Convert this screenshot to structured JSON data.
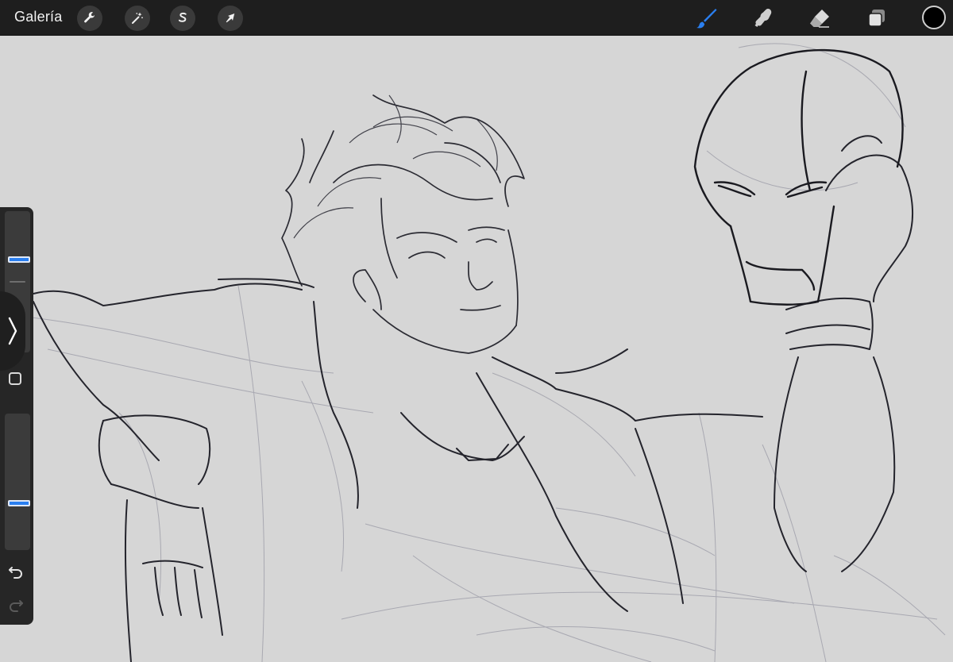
{
  "topbar": {
    "gallery_label": "Galería",
    "left_tools": [
      {
        "name": "actions",
        "icon": "wrench-icon"
      },
      {
        "name": "adjustments",
        "icon": "magic-wand-icon"
      },
      {
        "name": "selection",
        "icon": "selection-s-icon"
      },
      {
        "name": "transform",
        "icon": "arrow-cursor-icon"
      }
    ],
    "right_tools": [
      {
        "name": "brush",
        "icon": "brush-icon",
        "active": true
      },
      {
        "name": "smudge",
        "icon": "smudge-finger-icon",
        "active": false
      },
      {
        "name": "eraser",
        "icon": "eraser-icon",
        "active": false
      },
      {
        "name": "layers",
        "icon": "layers-icon",
        "active": false
      }
    ],
    "current_color": "#000000",
    "accent_color": "#2a7ff0"
  },
  "sidebar": {
    "brush_size_level": 0.3,
    "opacity_level": 0.65,
    "modify_icon": "square-icon",
    "undo_icon": "undo-arrow-icon",
    "redo_icon": "redo-arrow-icon",
    "collapse_icon": "chevron-right-icon"
  },
  "canvas": {
    "background": "#d6d6d6",
    "artwork": "sketch"
  }
}
